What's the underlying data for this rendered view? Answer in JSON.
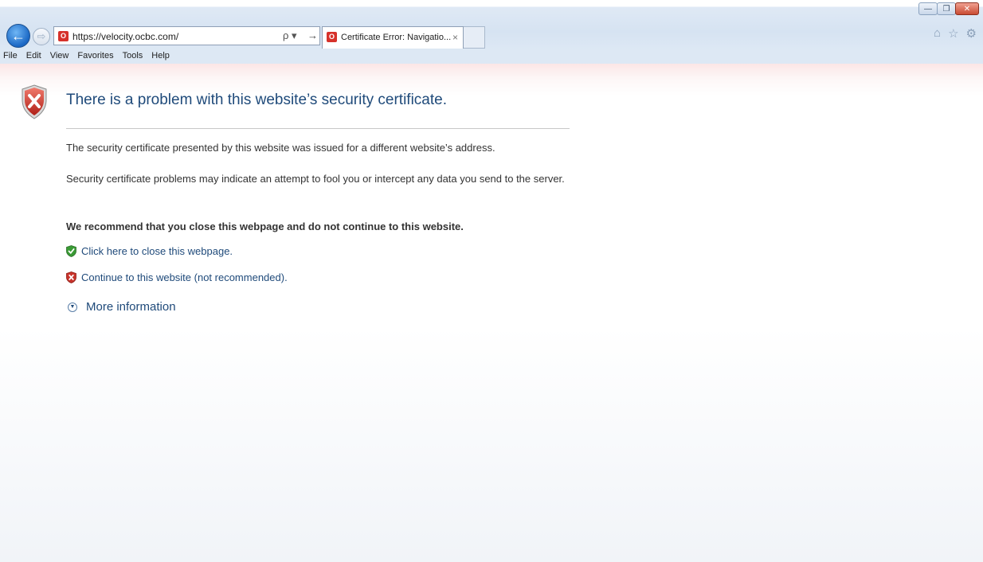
{
  "window": {
    "minimize_glyph": "—",
    "restore_glyph": "❐",
    "close_glyph": "✕"
  },
  "toolbar": {
    "back_glyph": "←",
    "forward_glyph": "⇨",
    "address_url": "https://velocity.ocbc.com/",
    "search_glyph": "ρ ▾",
    "go_glyph": "→",
    "home_glyph": "⌂",
    "favorites_glyph": "☆",
    "tools_glyph": "⚙"
  },
  "tab": {
    "title": "Certificate Error: Navigatio...",
    "close_glyph": "×"
  },
  "menu": {
    "items": [
      "File",
      "Edit",
      "View",
      "Favorites",
      "Tools",
      "Help"
    ]
  },
  "page": {
    "headline": "There is a problem with this website’s security certificate.",
    "paragraph_1": "The security certificate presented by this website was issued for a different website’s address.",
    "paragraph_2": "Security certificate problems may indicate an attempt to fool you or intercept any data you send to the server.",
    "recommendation": "We recommend that you close this webpage and do not continue to this website.",
    "close_link": "Click here to close this webpage.",
    "continue_link": "Continue to this website (not recommended).",
    "more_info": "More information"
  },
  "colors": {
    "link_blue": "#1f4a7a",
    "error_red": "#c8332b",
    "safe_green": "#3a9b35"
  }
}
